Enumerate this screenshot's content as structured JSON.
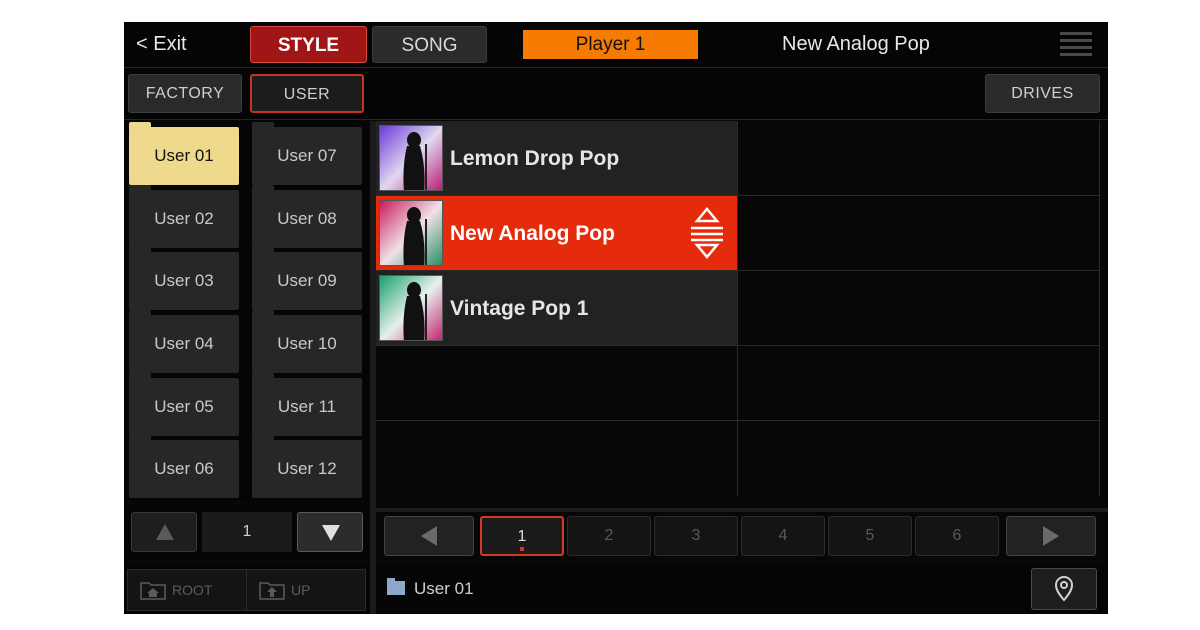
{
  "header": {
    "exit_label": "< Exit",
    "tab_style": "STYLE",
    "tab_song": "SONG",
    "player": "Player 1",
    "current_style": "New Analog Pop"
  },
  "subheader": {
    "factory": "FACTORY",
    "user": "USER",
    "drives": "DRIVES"
  },
  "folders": [
    {
      "label": "User 01",
      "active": true
    },
    {
      "label": "User 07",
      "active": false
    },
    {
      "label": "User 02",
      "active": false
    },
    {
      "label": "User 08",
      "active": false
    },
    {
      "label": "User 03",
      "active": false
    },
    {
      "label": "User 09",
      "active": false
    },
    {
      "label": "User 04",
      "active": false
    },
    {
      "label": "User 10",
      "active": false
    },
    {
      "label": "User 05",
      "active": false
    },
    {
      "label": "User 11",
      "active": false
    },
    {
      "label": "User 06",
      "active": false
    },
    {
      "label": "User 12",
      "active": false
    }
  ],
  "songs": [
    {
      "name": "Lemon Drop Pop",
      "selected": false
    },
    {
      "name": "New Analog Pop",
      "selected": true
    },
    {
      "name": "Vintage Pop 1",
      "selected": false
    }
  ],
  "left_pager": {
    "page": "1",
    "up_icon": "triangle-up-icon",
    "down_icon": "triangle-down-icon"
  },
  "right_pager": {
    "pages": [
      "1",
      "2",
      "3",
      "4",
      "5",
      "6"
    ],
    "active_page": "1"
  },
  "footer": {
    "root_label": "ROOT",
    "up_label": "UP",
    "path": "User 01",
    "locate_icon": "location-pin-icon"
  },
  "colors": {
    "accent_red": "#e52b0c",
    "style_tab": "#a01616",
    "player_orange": "#f57c00",
    "active_folder": "#efd98d"
  }
}
